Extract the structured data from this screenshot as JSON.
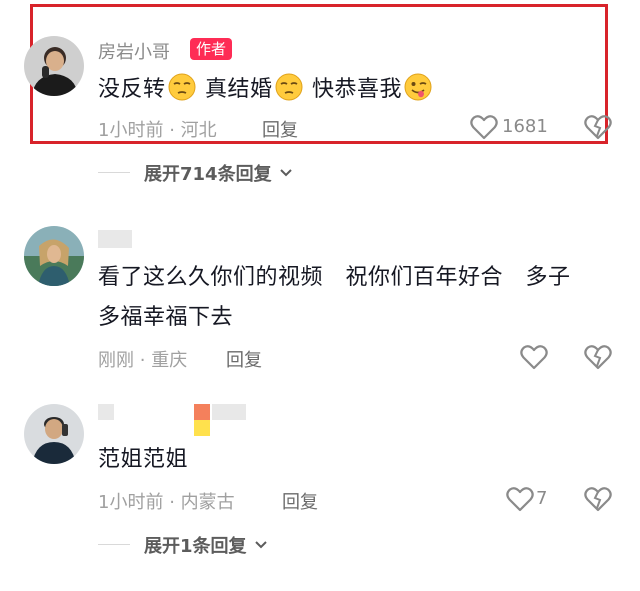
{
  "comments": [
    {
      "username": "房岩小哥",
      "author_tag": "作者",
      "content_parts": [
        "没反转",
        "真结婚",
        "快恭喜我"
      ],
      "time": "1小时前",
      "location": "河北",
      "reply_label": "回复",
      "likes": "1681",
      "expand_label": "展开714条回复"
    },
    {
      "content_line1": "看了这么久你们的视频   祝你们百年好合   多子",
      "content_line2": "多福幸福下去",
      "time": "刚刚",
      "location": "重庆",
      "reply_label": "回复"
    },
    {
      "content": "范姐范姐",
      "time": "1小时前",
      "location": "内蒙古",
      "reply_label": "回复",
      "likes": "7",
      "expand_label": "展开1条回复"
    }
  ],
  "separator": "·",
  "colors": {
    "highlight_border": "#d8232a",
    "author_tag": "#fe2c55"
  },
  "icons": [
    "heart-icon",
    "dislike-heart-icon",
    "chevron-down-icon",
    "unamused-emoji",
    "winking-tongue-emoji"
  ]
}
